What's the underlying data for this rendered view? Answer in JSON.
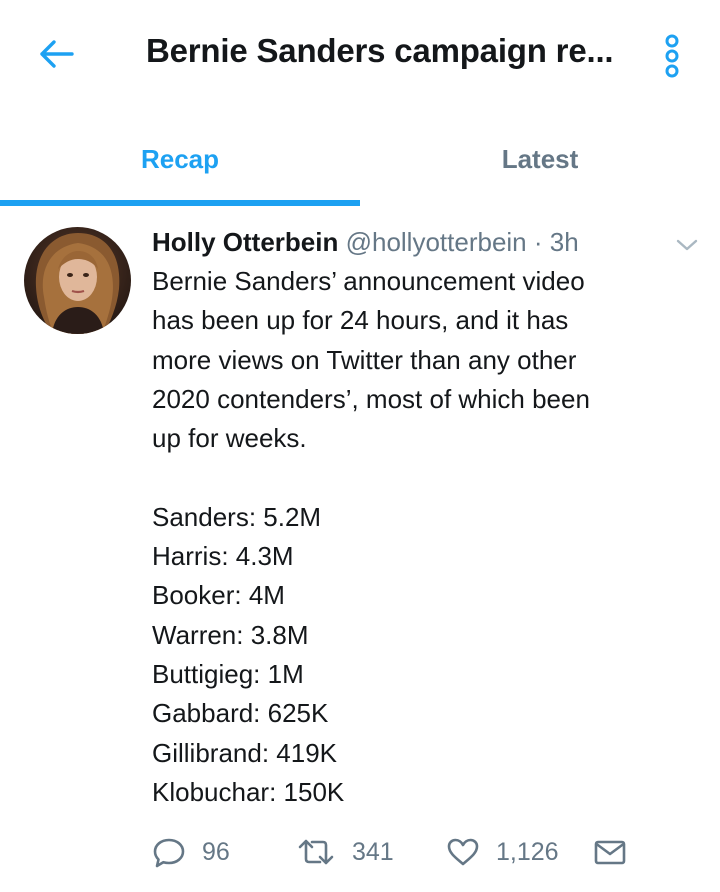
{
  "header": {
    "title": "Bernie Sanders campaign re...",
    "back_icon": "arrow-left-icon",
    "more_icon": "vertical-dots-icon"
  },
  "tabs": [
    {
      "label": "Recap",
      "active": true
    },
    {
      "label": "Latest",
      "active": false
    }
  ],
  "tweet": {
    "author": "Holly Otterbein",
    "handle": "@hollyotterbein",
    "separator": "·",
    "time": "3h",
    "text_lines": [
      "Bernie Sanders’ announcement video",
      "has been up for 24 hours, and it has",
      "more views on Twitter than any other",
      "2020 contenders’, most of which been",
      "up for weeks."
    ],
    "stats_lines": [
      "Sanders: 5.2M",
      "Harris: 4.3M",
      "Booker: 4M",
      "Warren: 3.8M",
      "Buttigieg: 1M",
      "Gabbard: 625K",
      "Gillibrand: 419K",
      "Klobuchar: 150K"
    ],
    "actions": {
      "replies": "96",
      "retweets": "341",
      "likes": "1,126"
    }
  },
  "colors": {
    "accent": "#1da1f2",
    "muted": "#657786",
    "text": "#14171a"
  }
}
